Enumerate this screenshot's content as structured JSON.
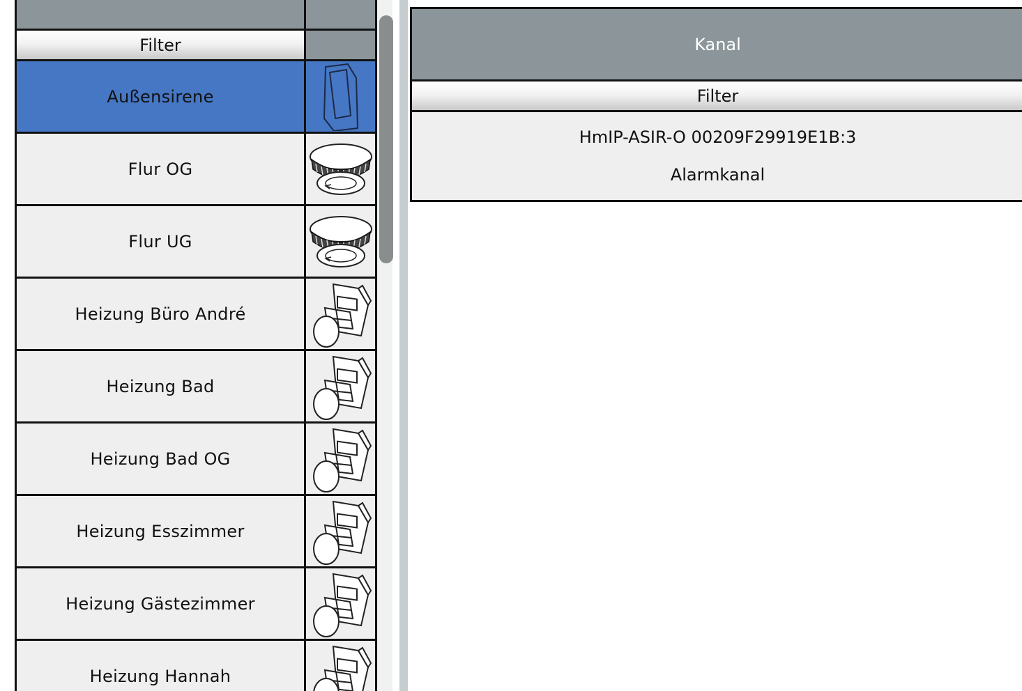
{
  "device_list": {
    "filter_label": "Filter",
    "rows": [
      {
        "name": "Außensirene",
        "icon": "outdoor-siren-icon",
        "selected": true
      },
      {
        "name": "Flur OG",
        "icon": "smoke-detector-icon",
        "selected": false
      },
      {
        "name": "Flur UG",
        "icon": "smoke-detector-icon",
        "selected": false
      },
      {
        "name": "Heizung Büro André",
        "icon": "radiator-thermostat-icon",
        "selected": false
      },
      {
        "name": "Heizung Bad",
        "icon": "radiator-thermostat-icon",
        "selected": false
      },
      {
        "name": "Heizung Bad OG",
        "icon": "radiator-thermostat-icon",
        "selected": false
      },
      {
        "name": "Heizung Esszimmer",
        "icon": "radiator-thermostat-icon",
        "selected": false
      },
      {
        "name": "Heizung Gästezimmer",
        "icon": "radiator-thermostat-icon",
        "selected": false
      },
      {
        "name": "Heizung Hannah",
        "icon": "radiator-thermostat-icon",
        "selected": false
      }
    ]
  },
  "channel_panel": {
    "header": "Kanal",
    "filter_label": "Filter",
    "rows": [
      {
        "address": "HmIP-ASIR-O 00209F29919E1B:3",
        "name": "Alarmkanal"
      }
    ]
  },
  "colors": {
    "header_bg": "#8c969a",
    "selected_bg": "#4677c4",
    "row_bg": "#efefef"
  }
}
